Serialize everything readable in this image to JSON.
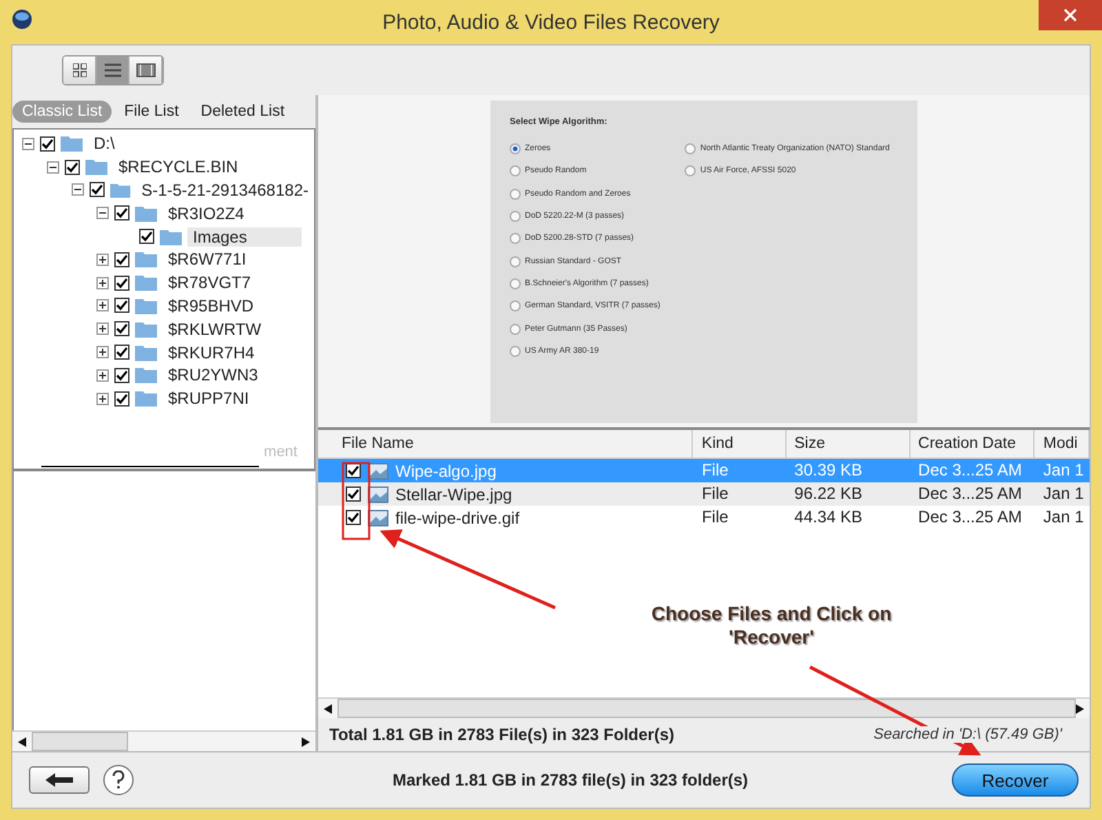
{
  "window": {
    "title": "Photo, Audio & Video Files Recovery"
  },
  "view_buttons": [
    {
      "kind": "grid",
      "selected": false
    },
    {
      "kind": "list",
      "selected": true
    },
    {
      "kind": "filmstrip",
      "selected": false
    }
  ],
  "tabs": [
    {
      "label": "Classic List",
      "selected": true
    },
    {
      "label": "File List",
      "selected": false
    },
    {
      "label": "Deleted List",
      "selected": false
    }
  ],
  "tree": [
    {
      "label": "D:\\",
      "checked": true,
      "expanded": true,
      "selected": false,
      "children": [
        {
          "label": "$RECYCLE.BIN",
          "checked": true,
          "expanded": true,
          "selected": false,
          "children": [
            {
              "label": "S-1-5-21-2913468182-",
              "checked": true,
              "expanded": true,
              "selected": false,
              "children": [
                {
                  "label": "$R3IO2Z4",
                  "checked": true,
                  "expanded": true,
                  "selected": false,
                  "children": [
                    {
                      "label": "Images",
                      "checked": true,
                      "selected": true
                    }
                  ]
                },
                {
                  "label": "$R6W771I",
                  "checked": true,
                  "expanded": false,
                  "selected": false
                },
                {
                  "label": "$R78VGT7",
                  "checked": true,
                  "expanded": false,
                  "selected": false
                },
                {
                  "label": "$R95BHVD",
                  "checked": true,
                  "expanded": false,
                  "selected": false
                },
                {
                  "label": "$RKLWRTW",
                  "checked": true,
                  "expanded": false,
                  "selected": false
                },
                {
                  "label": "$RKUR7H4",
                  "checked": true,
                  "expanded": false,
                  "selected": false
                },
                {
                  "label": "$RU2YWN3",
                  "checked": true,
                  "expanded": false,
                  "selected": false
                },
                {
                  "label": "$RUPP7NI",
                  "checked": true,
                  "expanded": false,
                  "selected": false
                }
              ]
            }
          ]
        }
      ]
    }
  ],
  "tree_overlay_text": "ment",
  "preview": {
    "title": "Select Wipe Algorithm:",
    "column_1": [
      {
        "label": "Zeroes",
        "selected": true
      },
      {
        "label": "Pseudo Random",
        "selected": false
      },
      {
        "label": "Pseudo Random and Zeroes",
        "selected": false
      },
      {
        "label": "DoD 5220.22-M (3 passes)",
        "selected": false
      },
      {
        "label": "DoD 5200.28-STD (7 passes)",
        "selected": false
      },
      {
        "label": "Russian Standard - GOST",
        "selected": false
      },
      {
        "label": "B.Schneier's Algorithm (7 passes)",
        "selected": false
      },
      {
        "label": "German Standard, VSITR (7 passes)",
        "selected": false
      },
      {
        "label": "Peter Gutmann (35 Passes)",
        "selected": false
      },
      {
        "label": "US Army AR 380-19",
        "selected": false
      }
    ],
    "column_2": [
      {
        "label": "North Atlantic Treaty Organization (NATO) Standard",
        "selected": false
      },
      {
        "label": "US Air Force, AFSSI 5020",
        "selected": false
      }
    ]
  },
  "table": {
    "columns": [
      "File Name",
      "Kind",
      "Size",
      "Creation Date",
      "Modi"
    ],
    "rows": [
      {
        "checked": true,
        "selected": true,
        "cells": [
          "Wipe-algo.jpg",
          "File",
          "30.39 KB",
          "Dec 3...25 AM",
          "Jan 1"
        ]
      },
      {
        "checked": true,
        "selected": false,
        "cells": [
          "Stellar-Wipe.jpg",
          "File",
          "96.22 KB",
          "Dec 3...25 AM",
          "Jan 1"
        ]
      },
      {
        "checked": true,
        "selected": false,
        "cells": [
          "file-wipe-drive.gif",
          "File",
          "44.34 KB",
          "Dec 3...25 AM",
          "Jan 1"
        ]
      }
    ]
  },
  "status": {
    "total": "Total 1.81 GB in 2783 File(s) in 323 Folder(s)",
    "searched": "Searched in 'D:\\ (57.49 GB)'"
  },
  "bottom": {
    "marked": "Marked 1.81 GB in 2783 file(s) in 323 folder(s)",
    "recover_button": "Recover"
  },
  "annotation": {
    "lines": [
      "Choose Files and Click on",
      "'Recover'"
    ]
  }
}
